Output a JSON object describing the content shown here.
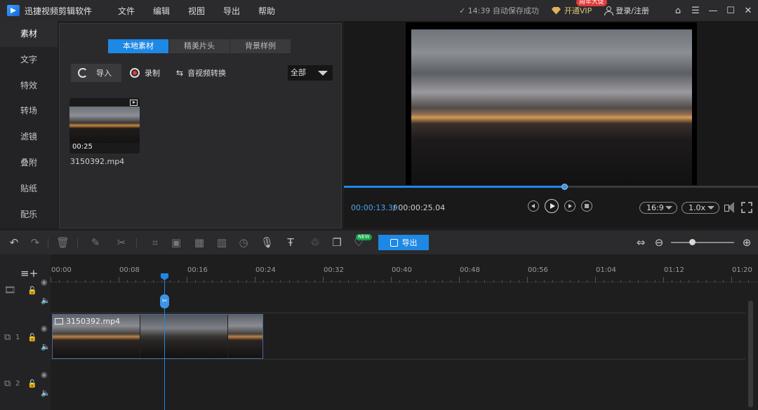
{
  "app": {
    "title": "迅捷视频剪辑软件"
  },
  "menu": [
    "文件",
    "编辑",
    "视图",
    "导出",
    "帮助"
  ],
  "titlebar": {
    "autosave": "✓ 14:39 自动保存成功",
    "vip_label": "开通VIP",
    "vip_badge": "周年大促",
    "login_label": "登录/注册"
  },
  "sidebar": {
    "items": [
      {
        "label": "素材",
        "active": true
      },
      {
        "label": "文字"
      },
      {
        "label": "特效"
      },
      {
        "label": "转场"
      },
      {
        "label": "滤镜"
      },
      {
        "label": "叠附"
      },
      {
        "label": "贴纸"
      },
      {
        "label": "配乐"
      }
    ]
  },
  "media": {
    "tabs": [
      {
        "label": "本地素材",
        "active": true
      },
      {
        "label": "精美片头"
      },
      {
        "label": "背景样例"
      }
    ],
    "import_label": "导入",
    "record_label": "录制",
    "convert_label": "音视频转换",
    "filter_value": "全部",
    "clip": {
      "name": "3150392.mp4",
      "duration": "00:25"
    }
  },
  "preview": {
    "current_time": "00:00:13.39",
    "total_time": "/ 00:00:25.04",
    "progress_percent": 53.3,
    "aspect_ratio": "16:9",
    "speed": "1.0x"
  },
  "toolbar": {
    "export_label": "导出",
    "new_badge": "NEW",
    "zoom_level_percent": 30
  },
  "timeline": {
    "ticks": [
      "00:00",
      "00:08",
      "00:16",
      "00:24",
      "00:32",
      "00:40",
      "00:48",
      "00:56",
      "01:04",
      "01:12",
      "01:20"
    ],
    "tracks": [
      {
        "number": ""
      },
      {
        "number": "1"
      },
      {
        "number": "2"
      }
    ],
    "clip_name": "3150392.mp4",
    "playhead_time": "00:13"
  },
  "colors": {
    "accent": "#1e88e5",
    "time_blue": "#4aa3f0",
    "record_red": "#e53935",
    "badge_red": "#e23a3a",
    "new_green": "#16a34a"
  }
}
